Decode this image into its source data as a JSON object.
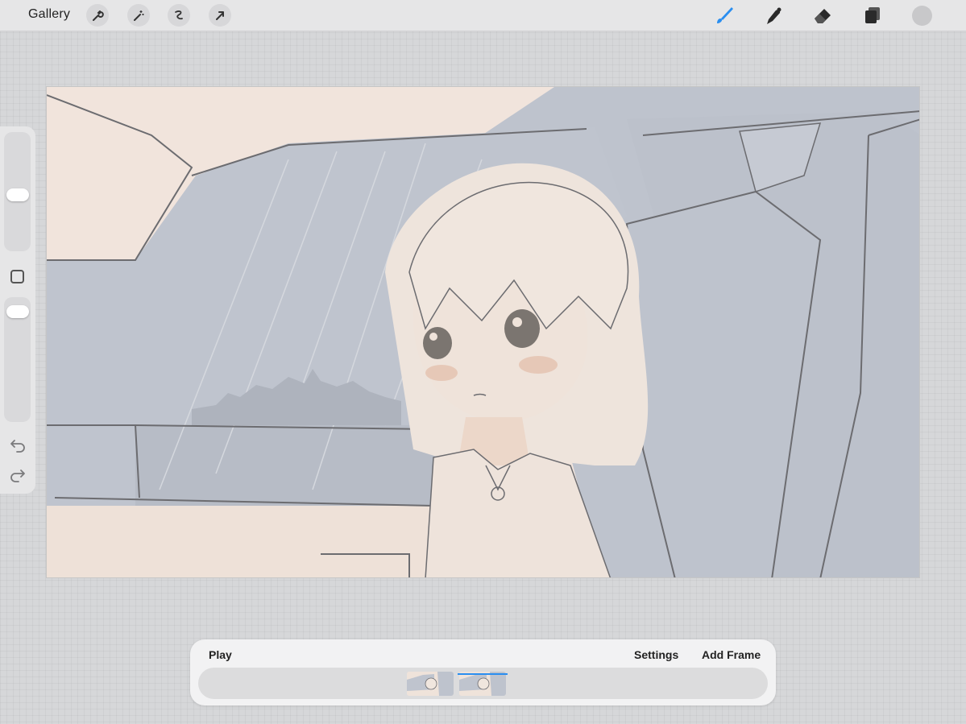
{
  "topbar": {
    "gallery_label": "Gallery",
    "left_tools": [
      "wrench-icon",
      "magic-wand-icon",
      "selection-icon",
      "transform-arrow-icon"
    ],
    "right_tools": [
      "brush-icon",
      "smudge-icon",
      "eraser-icon",
      "layers-icon"
    ],
    "active_tool": "brush-icon",
    "accent_color": "#2a8ef0",
    "current_color": "#c8c8ca"
  },
  "sidebar": {
    "controls": [
      "brush-size-slider",
      "modify-button",
      "opacity-slider",
      "undo-icon",
      "redo-icon"
    ]
  },
  "animation_assist": {
    "play_label": "Play",
    "settings_label": "Settings",
    "add_frame_label": "Add Frame",
    "frame_count": 2,
    "selected_frame": 2
  },
  "colors": {
    "canvas_bg": "#f1e4dc",
    "canvas_gray": "#bec3cd",
    "ui_bg": "#d6d7d9"
  }
}
